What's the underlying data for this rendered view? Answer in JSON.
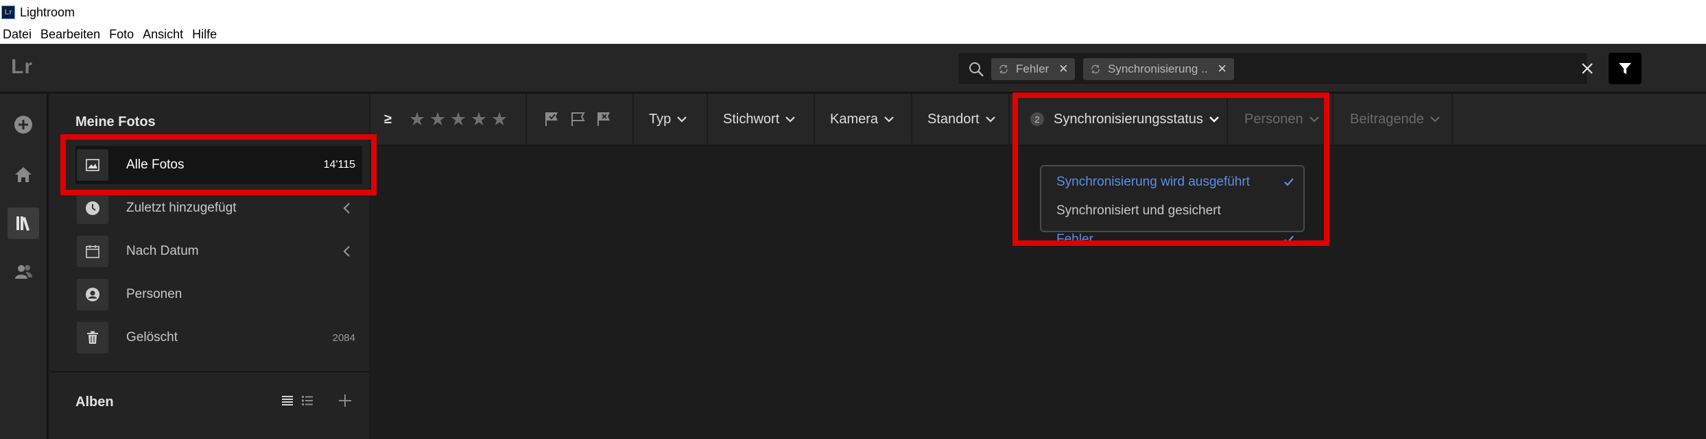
{
  "window": {
    "title": "Lightroom",
    "icon_text": "Lr",
    "menu": [
      "Datei",
      "Bearbeiten",
      "Foto",
      "Ansicht",
      "Hilfe"
    ]
  },
  "header": {
    "logo": "Lr",
    "search": {
      "chips": [
        {
          "label": "Fehler"
        },
        {
          "label": "Synchronisierung .."
        }
      ]
    }
  },
  "sidebar": {
    "my_photos_title": "Meine Fotos",
    "items": [
      {
        "label": "Alle Fotos",
        "count": "14'115"
      },
      {
        "label": "Zuletzt hinzugefügt",
        "count": ""
      },
      {
        "label": "Nach Datum",
        "count": ""
      },
      {
        "label": "Personen",
        "count": ""
      },
      {
        "label": "Gelöscht",
        "count": "2084"
      }
    ],
    "albums_title": "Alben"
  },
  "filterbar": {
    "rating_operator": "≥",
    "stars": 5,
    "filters": {
      "type": "Typ",
      "keyword": "Stichwort",
      "camera": "Kamera",
      "location": "Standort",
      "sync_status": "Synchronisierungsstatus",
      "sync_badge": "2",
      "people": "Personen",
      "contributors": "Beitragende"
    }
  },
  "sync_dropdown": {
    "options": [
      {
        "label": "Synchronisierung wird ausgeführt",
        "checked": true
      },
      {
        "label": "Synchronisiert und gesichert",
        "checked": false
      },
      {
        "label": "Fehler",
        "checked": true
      }
    ]
  },
  "colors": {
    "highlight": "#e00000",
    "accent_blue": "#5b8fe6",
    "panel": "#232323",
    "background": "#1c1c1c"
  }
}
